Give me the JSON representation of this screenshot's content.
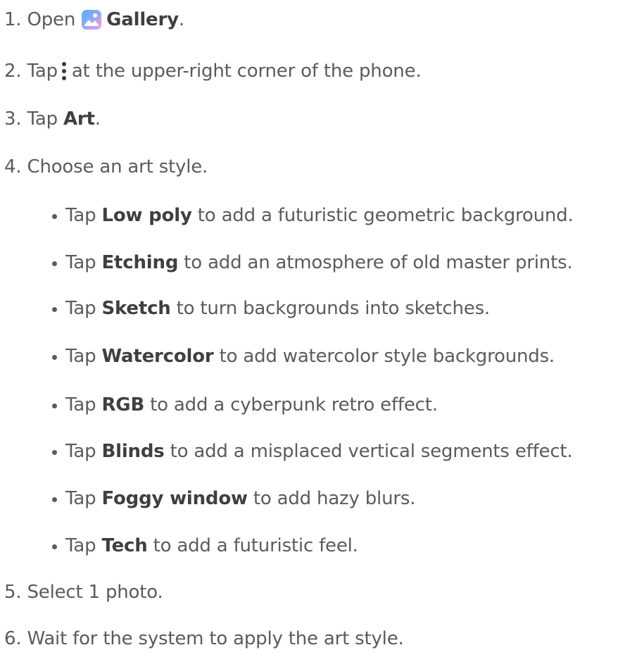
{
  "steps": [
    {
      "num": "1",
      "pre": "Open",
      "icon": "gallery-icon",
      "bold": "Gallery",
      "post": "."
    },
    {
      "num": "2",
      "pre": "Tap",
      "icon": "more-vertical-icon",
      "post": "at the upper-right corner of the phone."
    },
    {
      "num": "3",
      "pre": "Tap ",
      "bold": "Art",
      "post": "."
    },
    {
      "num": "4",
      "text": "Choose an art style."
    },
    {
      "num": "5",
      "text": "Select 1 photo."
    },
    {
      "num": "6",
      "text": "Wait for the system to apply the art style."
    }
  ],
  "styles": [
    {
      "pre": "Tap ",
      "bold": "Low poly",
      "post": " to add a futuristic geometric background."
    },
    {
      "pre": "Tap ",
      "bold": "Etching",
      "post": " to add an atmosphere of old master prints."
    },
    {
      "pre": "Tap ",
      "bold": "Sketch",
      "post": " to turn backgrounds into sketches."
    },
    {
      "pre": "Tap ",
      "bold": "Watercolor",
      "post": " to add watercolor style backgrounds."
    },
    {
      "pre": "Tap ",
      "bold": "RGB",
      "post": " to add a cyberpunk retro effect."
    },
    {
      "pre": "Tap ",
      "bold": "Blinds",
      "post": " to add a misplaced vertical segments effect."
    },
    {
      "pre": "Tap ",
      "bold": "Foggy window",
      "post": " to add hazy blurs."
    },
    {
      "pre": "Tap ",
      "bold": "Tech",
      "post": " to add a futuristic feel."
    }
  ],
  "colors": {
    "text": "#5b5b5b",
    "bold_text": "#3f3f3f",
    "gallery_icon_gradient": [
      "#3fb6ff",
      "#f39adf"
    ]
  }
}
